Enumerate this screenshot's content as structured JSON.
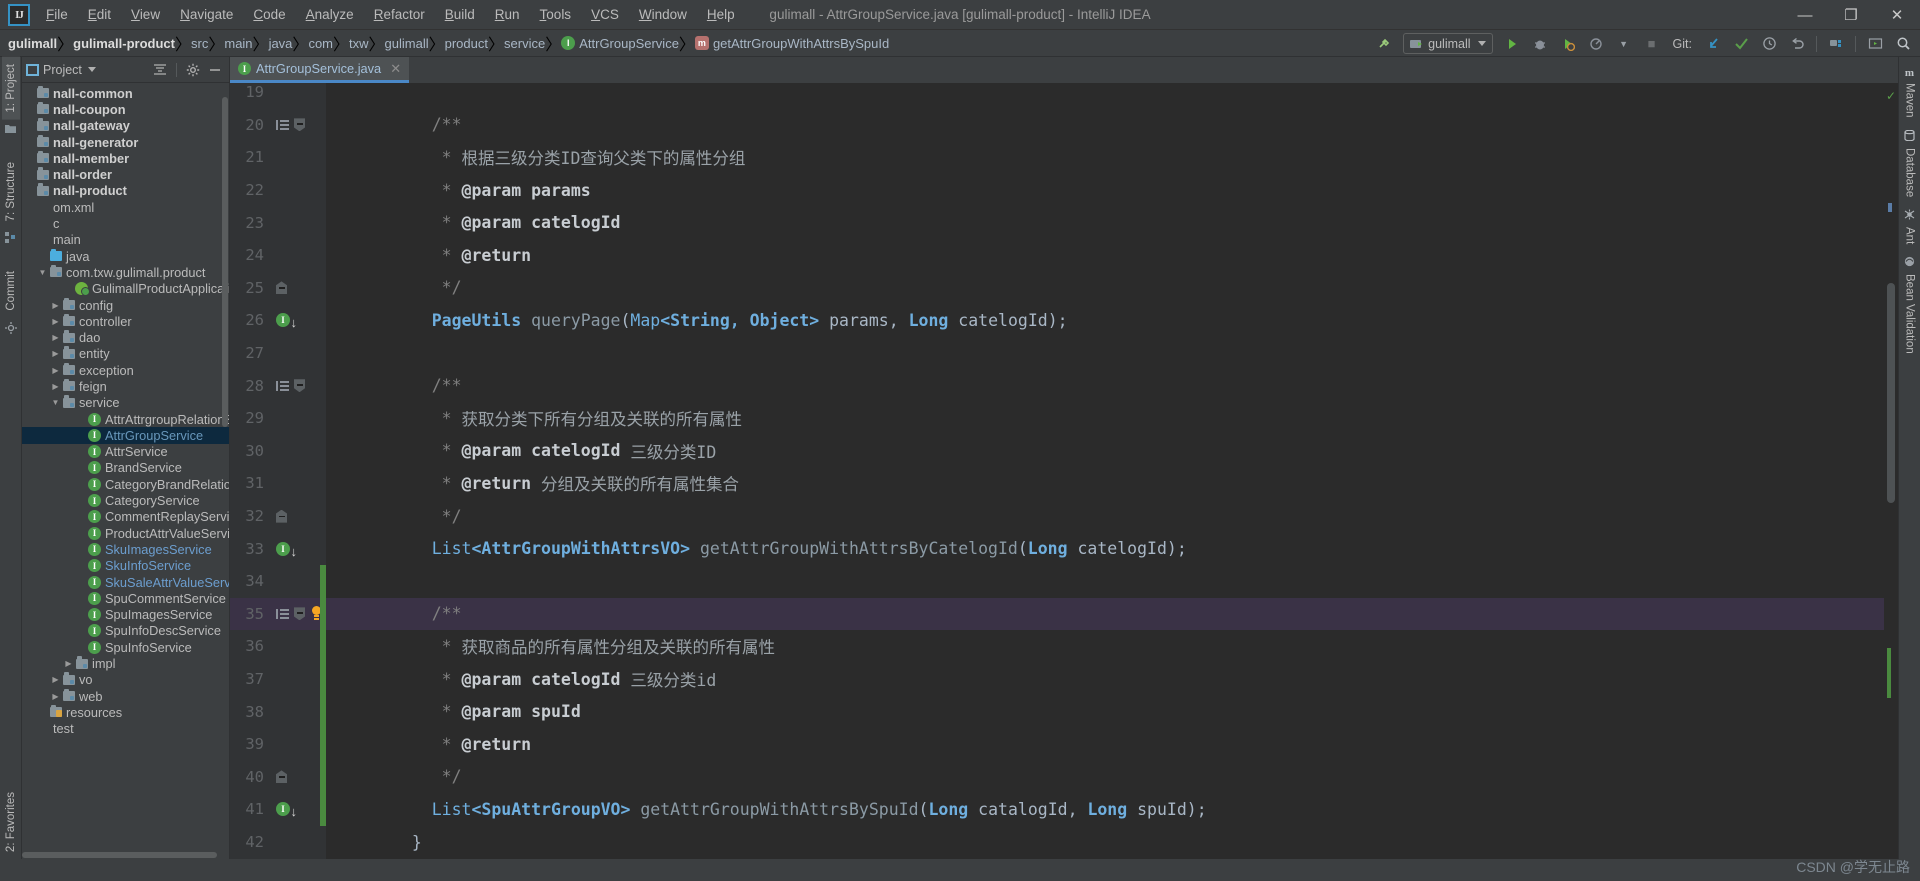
{
  "menubar": {
    "logo": "IJ",
    "items": [
      "File",
      "Edit",
      "View",
      "Navigate",
      "Code",
      "Analyze",
      "Refactor",
      "Build",
      "Run",
      "Tools",
      "VCS",
      "Window",
      "Help"
    ],
    "window_title": "gulimall - AttrGroupService.java [gulimall-product] - IntelliJ IDEA",
    "minimize": "—",
    "maximize": "❐",
    "close": "✕"
  },
  "navbar": {
    "breadcrumbs": [
      {
        "label": "gulimall",
        "bold": true,
        "icon": ""
      },
      {
        "label": "gulimall-product",
        "bold": true,
        "icon": ""
      },
      {
        "label": "src",
        "bold": false,
        "icon": ""
      },
      {
        "label": "main",
        "bold": false,
        "icon": ""
      },
      {
        "label": "java",
        "bold": false,
        "icon": ""
      },
      {
        "label": "com",
        "bold": false,
        "icon": ""
      },
      {
        "label": "txw",
        "bold": false,
        "icon": ""
      },
      {
        "label": "gulimall",
        "bold": false,
        "icon": ""
      },
      {
        "label": "product",
        "bold": false,
        "icon": ""
      },
      {
        "label": "service",
        "bold": false,
        "icon": ""
      },
      {
        "label": "AttrGroupService",
        "bold": false,
        "icon": "interface-icon"
      },
      {
        "label": "getAttrGroupWithAttrsBySpuId",
        "bold": false,
        "icon": "method-icon"
      }
    ],
    "separator": "〉",
    "run_config": "gulimall",
    "git_label": "Git:",
    "icons": [
      "build-icon",
      "run-icon",
      "debug-icon",
      "coverage-icon",
      "profile-icon",
      "stop-icon",
      "update-project-icon",
      "commit-icon",
      "history-icon",
      "rollback-icon",
      "project-structure-icon",
      "terminal-icon",
      "search-everywhere-icon"
    ]
  },
  "left_strip": {
    "tabs": [
      "1: Project",
      "7: Structure",
      "Commit"
    ],
    "bottom_tab": "2: Favorites"
  },
  "project_pane": {
    "title": "Project",
    "actions": [
      "collapse-all-icon",
      "settings-gear-icon",
      "hide-icon"
    ],
    "tree": [
      {
        "indent": 0,
        "arrow": "",
        "icon": "module-folder",
        "label": "nall-common",
        "bold": true,
        "selected": false
      },
      {
        "indent": 0,
        "arrow": "",
        "icon": "module-folder",
        "label": "nall-coupon",
        "bold": true,
        "selected": false
      },
      {
        "indent": 0,
        "arrow": "",
        "icon": "module-folder",
        "label": "nall-gateway",
        "bold": true,
        "selected": false
      },
      {
        "indent": 0,
        "arrow": "",
        "icon": "module-folder",
        "label": "nall-generator",
        "bold": true,
        "selected": false
      },
      {
        "indent": 0,
        "arrow": "",
        "icon": "module-folder",
        "label": "nall-member",
        "bold": true,
        "selected": false
      },
      {
        "indent": 0,
        "arrow": "",
        "icon": "module-folder",
        "label": "nall-order",
        "bold": true,
        "selected": false
      },
      {
        "indent": 0,
        "arrow": "",
        "icon": "module-folder",
        "label": "nall-product",
        "bold": true,
        "selected": false
      },
      {
        "indent": 0,
        "arrow": "",
        "icon": "xml-file",
        "label": "om.xml",
        "bold": false,
        "selected": false
      },
      {
        "indent": 0,
        "arrow": "",
        "icon": "",
        "label": "c",
        "bold": false,
        "selected": false
      },
      {
        "indent": 0,
        "arrow": "",
        "icon": "",
        "label": "main",
        "bold": false,
        "selected": false
      },
      {
        "indent": 1,
        "arrow": "",
        "icon": "source-folder",
        "label": "java",
        "bold": false,
        "selected": false
      },
      {
        "indent": 1,
        "arrow": "▼",
        "icon": "package",
        "label": "com.txw.gulimall.product",
        "bold": false,
        "selected": false
      },
      {
        "indent": 3,
        "arrow": "",
        "icon": "spring-app",
        "label": "GulimallProductApplication",
        "bold": false,
        "selected": false
      },
      {
        "indent": 2,
        "arrow": "▶",
        "icon": "package",
        "label": "config",
        "bold": false,
        "selected": false
      },
      {
        "indent": 2,
        "arrow": "▶",
        "icon": "package",
        "label": "controller",
        "bold": false,
        "selected": false
      },
      {
        "indent": 2,
        "arrow": "▶",
        "icon": "package",
        "label": "dao",
        "bold": false,
        "selected": false
      },
      {
        "indent": 2,
        "arrow": "▶",
        "icon": "package",
        "label": "entity",
        "bold": false,
        "selected": false
      },
      {
        "indent": 2,
        "arrow": "▶",
        "icon": "package",
        "label": "exception",
        "bold": false,
        "selected": false
      },
      {
        "indent": 2,
        "arrow": "▶",
        "icon": "package",
        "label": "feign",
        "bold": false,
        "selected": false
      },
      {
        "indent": 2,
        "arrow": "▼",
        "icon": "package",
        "label": "service",
        "bold": false,
        "selected": false
      },
      {
        "indent": 4,
        "arrow": "",
        "icon": "interface",
        "label": "AttrAttrgroupRelationService",
        "bold": false,
        "selected": false
      },
      {
        "indent": 4,
        "arrow": "",
        "icon": "interface",
        "label": "AttrGroupService",
        "bold": false,
        "selected": true
      },
      {
        "indent": 4,
        "arrow": "",
        "icon": "interface",
        "label": "AttrService",
        "bold": false,
        "selected": false
      },
      {
        "indent": 4,
        "arrow": "",
        "icon": "interface",
        "label": "BrandService",
        "bold": false,
        "selected": false
      },
      {
        "indent": 4,
        "arrow": "",
        "icon": "interface",
        "label": "CategoryBrandRelationService",
        "bold": false,
        "selected": false
      },
      {
        "indent": 4,
        "arrow": "",
        "icon": "interface",
        "label": "CategoryService",
        "bold": false,
        "selected": false
      },
      {
        "indent": 4,
        "arrow": "",
        "icon": "interface",
        "label": "CommentReplayService",
        "bold": false,
        "selected": false
      },
      {
        "indent": 4,
        "arrow": "",
        "icon": "interface",
        "label": "ProductAttrValueService",
        "bold": false,
        "selected": false
      },
      {
        "indent": 4,
        "arrow": "",
        "icon": "interface",
        "label": "SkuImagesService",
        "bold": false,
        "selected": false,
        "blue": true
      },
      {
        "indent": 4,
        "arrow": "",
        "icon": "interface",
        "label": "SkuInfoService",
        "bold": false,
        "selected": false,
        "blue": true
      },
      {
        "indent": 4,
        "arrow": "",
        "icon": "interface",
        "label": "SkuSaleAttrValueService",
        "bold": false,
        "selected": false,
        "blue": true
      },
      {
        "indent": 4,
        "arrow": "",
        "icon": "interface",
        "label": "SpuCommentService",
        "bold": false,
        "selected": false
      },
      {
        "indent": 4,
        "arrow": "",
        "icon": "interface",
        "label": "SpuImagesService",
        "bold": false,
        "selected": false
      },
      {
        "indent": 4,
        "arrow": "",
        "icon": "interface",
        "label": "SpuInfoDescService",
        "bold": false,
        "selected": false
      },
      {
        "indent": 4,
        "arrow": "",
        "icon": "interface",
        "label": "SpuInfoService",
        "bold": false,
        "selected": false
      },
      {
        "indent": 3,
        "arrow": "▶",
        "icon": "package",
        "label": "impl",
        "bold": false,
        "selected": false
      },
      {
        "indent": 2,
        "arrow": "▶",
        "icon": "package",
        "label": "vo",
        "bold": false,
        "selected": false
      },
      {
        "indent": 2,
        "arrow": "▶",
        "icon": "package",
        "label": "web",
        "bold": false,
        "selected": false
      },
      {
        "indent": 1,
        "arrow": "",
        "icon": "resource-folder",
        "label": "resources",
        "bold": false,
        "selected": false
      },
      {
        "indent": 0,
        "arrow": "",
        "icon": "",
        "label": "test",
        "bold": false,
        "selected": false
      }
    ]
  },
  "editor": {
    "tab": {
      "label": "AttrGroupService.java",
      "icon": "interface-icon",
      "close": "✕"
    },
    "first_line": 19,
    "lines": [
      {
        "num": 19,
        "gutter": [],
        "tokens": [],
        "highlight": false,
        "vcs": false
      },
      {
        "num": 20,
        "gutter": [
          "doc-comment-icon",
          "fold-start-icon"
        ],
        "tokens": [
          {
            "t": "cmt",
            "v": "    /**"
          }
        ],
        "highlight": false,
        "vcs": false
      },
      {
        "num": 21,
        "gutter": [],
        "tokens": [
          {
            "t": "cmt",
            "v": "     * "
          },
          {
            "t": "cmt-txt",
            "v": "根据三级分类ID查询父类下的属性分组"
          }
        ],
        "highlight": false,
        "vcs": false
      },
      {
        "num": 22,
        "gutter": [],
        "tokens": [
          {
            "t": "cmt",
            "v": "     * "
          },
          {
            "t": "cmt-tag",
            "v": "@param"
          },
          {
            "t": "cmt-tag",
            "v": " params"
          }
        ],
        "highlight": false,
        "vcs": false
      },
      {
        "num": 23,
        "gutter": [],
        "tokens": [
          {
            "t": "cmt",
            "v": "     * "
          },
          {
            "t": "cmt-tag",
            "v": "@param"
          },
          {
            "t": "cmt-tag",
            "v": " catelogId"
          }
        ],
        "highlight": false,
        "vcs": false
      },
      {
        "num": 24,
        "gutter": [],
        "tokens": [
          {
            "t": "cmt",
            "v": "     * "
          },
          {
            "t": "cmt-tag",
            "v": "@return"
          }
        ],
        "highlight": false,
        "vcs": false
      },
      {
        "num": 25,
        "gutter": [
          "fold-end-icon"
        ],
        "tokens": [
          {
            "t": "cmt",
            "v": "     */"
          }
        ],
        "highlight": false,
        "vcs": false
      },
      {
        "num": 26,
        "gutter": [
          "implemented-icon"
        ],
        "tokens": [
          {
            "t": "type",
            "v": "    PageUtils"
          },
          {
            "t": "mth",
            "v": " queryPage"
          },
          {
            "t": "punct",
            "v": "("
          },
          {
            "t": "type2",
            "v": "Map"
          },
          {
            "t": "type",
            "v": "<String, Object>"
          },
          {
            "t": "plain",
            "v": " params"
          },
          {
            "t": "punct",
            "v": ", "
          },
          {
            "t": "type",
            "v": "Long"
          },
          {
            "t": "plain",
            "v": " catelogId"
          },
          {
            "t": "punct",
            "v": ");"
          }
        ],
        "highlight": false,
        "vcs": false
      },
      {
        "num": 27,
        "gutter": [],
        "tokens": [],
        "highlight": false,
        "vcs": false
      },
      {
        "num": 28,
        "gutter": [
          "doc-comment-icon",
          "fold-start-icon"
        ],
        "tokens": [
          {
            "t": "cmt",
            "v": "    /**"
          }
        ],
        "highlight": false,
        "vcs": false
      },
      {
        "num": 29,
        "gutter": [],
        "tokens": [
          {
            "t": "cmt",
            "v": "     * "
          },
          {
            "t": "cmt-txt",
            "v": "获取分类下所有分组及关联的所有属性"
          }
        ],
        "highlight": false,
        "vcs": false
      },
      {
        "num": 30,
        "gutter": [],
        "tokens": [
          {
            "t": "cmt",
            "v": "     * "
          },
          {
            "t": "cmt-tag",
            "v": "@param"
          },
          {
            "t": "cmt-tag",
            "v": " catelogId"
          },
          {
            "t": "cmt-txt",
            "v": " 三级分类ID"
          }
        ],
        "highlight": false,
        "vcs": false
      },
      {
        "num": 31,
        "gutter": [],
        "tokens": [
          {
            "t": "cmt",
            "v": "     * "
          },
          {
            "t": "cmt-tag",
            "v": "@return"
          },
          {
            "t": "cmt-txt",
            "v": " 分组及关联的所有属性集合"
          }
        ],
        "highlight": false,
        "vcs": false
      },
      {
        "num": 32,
        "gutter": [
          "fold-end-icon"
        ],
        "tokens": [
          {
            "t": "cmt",
            "v": "     */"
          }
        ],
        "highlight": false,
        "vcs": false
      },
      {
        "num": 33,
        "gutter": [
          "implemented-icon"
        ],
        "tokens": [
          {
            "t": "type2",
            "v": "    List"
          },
          {
            "t": "type",
            "v": "<AttrGroupWithAttrsVO>"
          },
          {
            "t": "mth",
            "v": " getAttrGroupWithAttrsByCatelogId"
          },
          {
            "t": "punct",
            "v": "("
          },
          {
            "t": "type",
            "v": "Long"
          },
          {
            "t": "plain",
            "v": " catelogId"
          },
          {
            "t": "punct",
            "v": ");"
          }
        ],
        "highlight": false,
        "vcs": false
      },
      {
        "num": 34,
        "gutter": [],
        "tokens": [],
        "highlight": false,
        "vcs": true
      },
      {
        "num": 35,
        "gutter": [
          "doc-comment-icon",
          "fold-start-icon",
          "intention-bulb-icon"
        ],
        "tokens": [
          {
            "t": "cmt",
            "v": "    /**"
          }
        ],
        "highlight": true,
        "vcs": true
      },
      {
        "num": 36,
        "gutter": [],
        "tokens": [
          {
            "t": "cmt",
            "v": "     * "
          },
          {
            "t": "cmt-txt",
            "v": "获取商品的所有属性分组及关联的所有属性"
          }
        ],
        "highlight": false,
        "vcs": true
      },
      {
        "num": 37,
        "gutter": [],
        "tokens": [
          {
            "t": "cmt",
            "v": "     * "
          },
          {
            "t": "cmt-tag",
            "v": "@param"
          },
          {
            "t": "cmt-tag",
            "v": " catelogId"
          },
          {
            "t": "cmt-txt",
            "v": " 三级分类id"
          }
        ],
        "highlight": false,
        "vcs": true
      },
      {
        "num": 38,
        "gutter": [],
        "tokens": [
          {
            "t": "cmt",
            "v": "     * "
          },
          {
            "t": "cmt-tag",
            "v": "@param"
          },
          {
            "t": "cmt-tag",
            "v": " spuId"
          }
        ],
        "highlight": false,
        "vcs": true
      },
      {
        "num": 39,
        "gutter": [],
        "tokens": [
          {
            "t": "cmt",
            "v": "     * "
          },
          {
            "t": "cmt-tag",
            "v": "@return"
          }
        ],
        "highlight": false,
        "vcs": true
      },
      {
        "num": 40,
        "gutter": [
          "fold-end-icon"
        ],
        "tokens": [
          {
            "t": "cmt",
            "v": "     */"
          }
        ],
        "highlight": false,
        "vcs": true
      },
      {
        "num": 41,
        "gutter": [
          "implemented-icon"
        ],
        "tokens": [
          {
            "t": "type2",
            "v": "    List"
          },
          {
            "t": "type",
            "v": "<SpuAttrGroupVO>"
          },
          {
            "t": "mth",
            "v": " getAttrGroupWithAttrsBySpuId"
          },
          {
            "t": "punct",
            "v": "("
          },
          {
            "t": "type",
            "v": "Long"
          },
          {
            "t": "plain",
            "v": " catalogId"
          },
          {
            "t": "punct",
            "v": ", "
          },
          {
            "t": "type",
            "v": "Long"
          },
          {
            "t": "plain",
            "v": " spuId"
          },
          {
            "t": "punct",
            "v": ");"
          }
        ],
        "highlight": false,
        "vcs": true
      },
      {
        "num": 42,
        "gutter": [],
        "tokens": [
          {
            "t": "punct",
            "v": "  }"
          }
        ],
        "highlight": false,
        "vcs": false
      }
    ]
  },
  "right_strip": {
    "tabs": [
      "Maven",
      "Database",
      "Ant",
      "Bean Validation"
    ]
  },
  "watermark": "CSDN @学无止路",
  "colors": {
    "chrome": "#3c3f41",
    "editor_bg": "#2b2b2b",
    "gutter_bg": "#313335",
    "accent_blue": "#4a88c7",
    "selection": "#0d293e",
    "highlight_line": "#3a3246",
    "vcs_green": "#4a8a3f",
    "keyword": "#cc7832",
    "type": "#6fafdf",
    "comment": "#808080",
    "bulb": "#f5a623"
  }
}
